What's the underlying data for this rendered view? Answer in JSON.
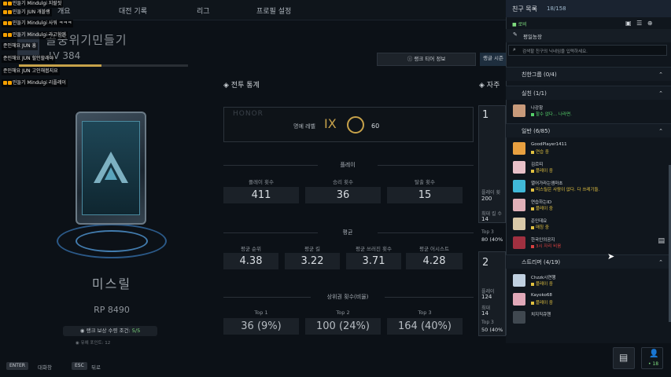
{
  "nav": {
    "tabs": [
      "개요",
      "대전 기록",
      "리그",
      "프로필 설정"
    ]
  },
  "chat": {
    "lines": [
      {
        "prefix": "",
        "text": "민들기 Mindulgi 지랄짓"
      },
      {
        "prefix": "",
        "text": "민들기 JUN 개블랭"
      },
      {
        "prefix": "",
        "text": "민들기 Mindulgi 사워 ㅋㅋㅋ"
      },
      {
        "prefix": "",
        "text": "민들기 Mindulgi 라고함엠"
      },
      {
        "prefix": "",
        "text": "민들기 Mindulgi 마지"
      },
      {
        "prefix": "준인해요",
        "text": "JUN 흥"
      },
      {
        "prefix": "준인해요",
        "text": "JUN 힐인할래야"
      },
      {
        "prefix": "준인해요",
        "text": "JUN 고인해봅지요"
      },
      {
        "prefix": "",
        "text": "민들기 Mindulgi 리플레이"
      }
    ]
  },
  "player": {
    "name": "골중위기민들기",
    "level": "LV 384",
    "xp_ratio": 0.49
  },
  "rank": {
    "name": "미스릴",
    "rp": "RP 8490",
    "reward_label": "랭크 보상 수령 조건:",
    "reward_value": "5/5",
    "reward_sub": "유예 포인트: 12"
  },
  "hints": [
    {
      "key": "ENTER",
      "label": "대화창"
    },
    {
      "key": "ESC",
      "label": "뒤로"
    }
  ],
  "stats": {
    "title": "전투 통계",
    "rank_tier_button": "랭크 티어 정보",
    "rank_series_button": "랭글 시즌",
    "honor": {
      "bg_text": "HONOR",
      "label": "명예 레벨",
      "level": "IX",
      "value": "60"
    },
    "play": {
      "title": "플레이",
      "items": [
        {
          "label": "플레이 횟수",
          "value": "411"
        },
        {
          "label": "승리 횟수",
          "value": "36"
        },
        {
          "label": "탈출 횟수",
          "value": "15"
        }
      ]
    },
    "avg": {
      "title": "평균",
      "items": [
        {
          "label": "평균 순위",
          "value": "4.38"
        },
        {
          "label": "평균 킬",
          "value": "3.22"
        },
        {
          "label": "평균 쓰러진 횟수",
          "value": "3.71"
        },
        {
          "label": "평균 어시스트",
          "value": "4.28"
        }
      ]
    },
    "top": {
      "title": "상위권 횟수(비율)",
      "items": [
        {
          "label": "Top 1",
          "value": "36 (9%)"
        },
        {
          "label": "Top 2",
          "value": "100 (24%)"
        },
        {
          "label": "Top 3",
          "value": "164 (40%)"
        }
      ]
    }
  },
  "side": {
    "title": "자주",
    "card1": {
      "num": "1",
      "l1": "플레이 횟",
      "v1": "200",
      "l2": "최대 킬 수",
      "v2": "14",
      "l3": "Top 3",
      "v3": "80 (40%"
    },
    "card2": {
      "num": "2",
      "l1": "플레이",
      "v1": "124",
      "l2": "최대",
      "v2": "14",
      "l3": "Top 3",
      "v3": "50 (40%"
    }
  },
  "friends": {
    "title": "친구 목록",
    "count": "18/158",
    "my_status": "로비",
    "status_msg": "평일농장",
    "search_placeholder": "검색할 친구의 닉네임을 입력하세요.",
    "groups": [
      {
        "name": "친한그룹 (0/4)",
        "items": []
      },
      {
        "name": "실친 (1/1)",
        "items": [
          {
            "name": "나강항",
            "status": "할수 없다... 나라면.",
            "color": "#55d06a",
            "avatar": "#c89a7a"
          }
        ]
      },
      {
        "name": "일반 (6/85)",
        "items": [
          {
            "name": "GoodPlayer1411",
            "status": "연습 중",
            "color": "#e0c040",
            "avatar": "#e8a040"
          },
          {
            "name": "김르띠",
            "status": "플레이 중",
            "color": "#e0c040",
            "avatar": "#e8c0c8"
          },
          {
            "name": "멸어가라는엠마초",
            "status": "미스릴은 사람이 없다. 다 쓰레기들.",
            "color": "#e0c040",
            "avatar": "#40b8d8"
          },
          {
            "name": "연습하는ID",
            "status": "플레이 중",
            "color": "#e0c040",
            "avatar": "#e0b0b8"
          },
          {
            "name": "준인데요",
            "status": "매칭 중",
            "color": "#e0c040",
            "avatar": "#d8c8a8"
          },
          {
            "name": "한국인의공지",
            "status": "3시 자리 비움",
            "color": "#d84040",
            "avatar": "#a03040"
          }
        ]
      },
      {
        "name": "스트리머 (4/19)",
        "items": [
          {
            "name": "Chzzk시연행",
            "status": "플레이 중",
            "color": "#e0c040",
            "avatar": "#c0d0e0"
          },
          {
            "name": "Kayoko68",
            "status": "플레이 중",
            "color": "#e0c040",
            "avatar": "#e0a8b8"
          },
          {
            "name": "치지직큐헨",
            "status": "",
            "color": "#e0c040",
            "avatar": "#404850"
          }
        ]
      }
    ],
    "online_count": "18"
  },
  "colors": {
    "accent_gold": "#c7a24a",
    "online_green": "#55d06a",
    "playing_yellow": "#e0c040",
    "away_red": "#d84040"
  }
}
